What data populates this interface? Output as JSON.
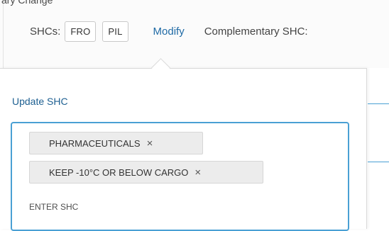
{
  "header": {
    "partial_text": "ary Change",
    "shcs_label": "SHCs:",
    "shc_codes": [
      "FRO",
      "PIL"
    ],
    "modify_label": "Modify",
    "complementary_label": "Complementary SHC:"
  },
  "popover": {
    "title": "Update SHC",
    "selected_tags": [
      "PHARMACEUTICALS",
      "KEEP -10°C OR BELOW CARGO"
    ],
    "remove_glyph": "×",
    "input_placeholder": "ENTER SHC",
    "input_value": ""
  },
  "colors": {
    "accent": "#4aa0d4",
    "link": "#1f6aa5",
    "title": "#1d5f91"
  }
}
